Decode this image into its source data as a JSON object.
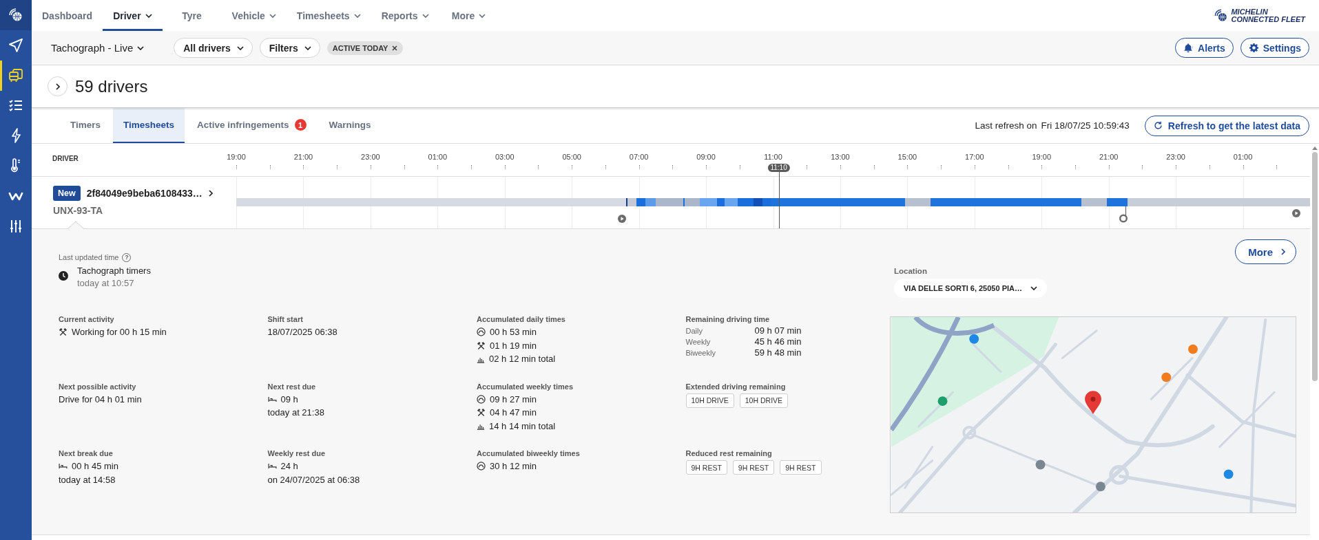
{
  "sidebar": {
    "items": [
      {
        "kind": "navigate",
        "selected": false
      },
      {
        "kind": "vehicles",
        "selected": true
      },
      {
        "kind": "checklist",
        "selected": false
      },
      {
        "kind": "energy",
        "selected": false
      },
      {
        "kind": "temperature",
        "selected": false
      },
      {
        "kind": "zigzag",
        "selected": false
      },
      {
        "kind": "sliders",
        "selected": false
      }
    ]
  },
  "top_nav": {
    "items": [
      {
        "label": "Dashboard",
        "has_menu": false,
        "selected": false
      },
      {
        "label": "Driver",
        "has_menu": true,
        "selected": true
      },
      {
        "label": "Tyre",
        "has_menu": false,
        "selected": false
      },
      {
        "label": "Vehicle",
        "has_menu": true,
        "selected": false
      },
      {
        "label": "Timesheets",
        "has_menu": true,
        "selected": false
      },
      {
        "label": "Reports",
        "has_menu": true,
        "selected": false
      },
      {
        "label": "More",
        "has_menu": true,
        "selected": false
      }
    ],
    "brand": [
      "MICHELIN",
      "CONNECTED FLEET"
    ]
  },
  "toolbar": {
    "view": "Tachograph - Live",
    "dropdowns": [
      "All drivers",
      "Filters"
    ],
    "chips": [
      "ACTIVE TODAY"
    ],
    "buttons": [
      {
        "kind": "alerts",
        "label": "Alerts"
      },
      {
        "kind": "settings",
        "label": "Settings"
      }
    ]
  },
  "header": {
    "title": "59 drivers"
  },
  "tabs": [
    {
      "label": "Timers",
      "selected": false
    },
    {
      "label": "Timesheets",
      "selected": true
    },
    {
      "label": "Active infringements",
      "selected": false,
      "badge": "1"
    },
    {
      "label": "Warnings",
      "selected": false
    }
  ],
  "refresh": {
    "label": "Last refresh on",
    "time": "Fri 18/07/25 10:59:43",
    "button": "Refresh to get the latest data"
  },
  "timeline": {
    "column": "DRIVER",
    "hours": [
      "19:00",
      "21:00",
      "23:00",
      "01:00",
      "03:00",
      "05:00",
      "07:00",
      "09:00",
      "11:00",
      "13:00",
      "15:00",
      "17:00",
      "19:00",
      "21:00",
      "23:00",
      "01:00"
    ],
    "now": "11:10"
  },
  "driver": {
    "badge": "New",
    "id": "2f84049e9beba6108433…",
    "plate": "UNX-93-TA"
  },
  "details": {
    "last_updated": {
      "label": "Last updated time",
      "help": "?",
      "source": "Tachograph timers",
      "time": "today at 10:57"
    },
    "sections": [
      {
        "kind": "lines",
        "title": "Current activity",
        "lines": [
          {
            "kind": "work",
            "text": "Working for 00 h 15 min"
          }
        ]
      },
      {
        "kind": "lines",
        "title": "Shift start",
        "lines": [
          {
            "kind": "plain",
            "text": "18/07/2025 06:38"
          }
        ]
      },
      {
        "kind": "lines",
        "title": "Accumulated daily times",
        "lines": [
          {
            "kind": "driving",
            "text": "00 h 53 min"
          },
          {
            "kind": "work",
            "text": "01 h 19 min"
          },
          {
            "kind": "total",
            "text": "02 h 12 min total"
          }
        ]
      },
      {
        "kind": "table",
        "title": "Remaining driving time",
        "rows": [
          {
            "label": "Daily",
            "value": "09 h 07 min"
          },
          {
            "label": "Weekly",
            "value": "45 h 46 min"
          },
          {
            "label": "Biweekly",
            "value": "59 h 48 min"
          }
        ]
      },
      {
        "kind": "lines",
        "title": "Next possible activity",
        "lines": [
          {
            "kind": "plain",
            "text": "Drive for 04 h 01 min"
          }
        ]
      },
      {
        "kind": "lines",
        "title": "Next rest due",
        "lines": [
          {
            "kind": "rest",
            "text": "09 h"
          },
          {
            "kind": "plain",
            "text": "today at 21:38"
          }
        ]
      },
      {
        "kind": "lines",
        "title": "Accumulated weekly times",
        "lines": [
          {
            "kind": "driving",
            "text": "09 h 27 min"
          },
          {
            "kind": "work",
            "text": "04 h 47 min"
          },
          {
            "kind": "total",
            "text": "14 h 14 min total"
          }
        ]
      },
      {
        "kind": "chips",
        "title": "Extended driving remaining",
        "chips": [
          "10H DRIVE",
          "10H DRIVE"
        ]
      },
      {
        "kind": "lines",
        "title": "Next break due",
        "lines": [
          {
            "kind": "rest",
            "text": "00 h 45 min"
          },
          {
            "kind": "plain",
            "text": "today at 14:58"
          }
        ]
      },
      {
        "kind": "lines",
        "title": "Weekly rest due",
        "lines": [
          {
            "kind": "rest",
            "text": "24 h"
          },
          {
            "kind": "plain",
            "text": "on 24/07/2025 at 06:38"
          }
        ]
      },
      {
        "kind": "lines",
        "title": "Accumulated biweekly times",
        "lines": [
          {
            "kind": "driving",
            "text": "30 h 12 min"
          }
        ]
      },
      {
        "kind": "chips",
        "title": "Reduced rest remaining",
        "chips": [
          "9H REST",
          "9H REST",
          "9H REST"
        ]
      }
    ],
    "more_button": "More",
    "location": {
      "label": "Location",
      "value": "VIA DELLE SORTI 6, 25050 PIA…"
    }
  }
}
